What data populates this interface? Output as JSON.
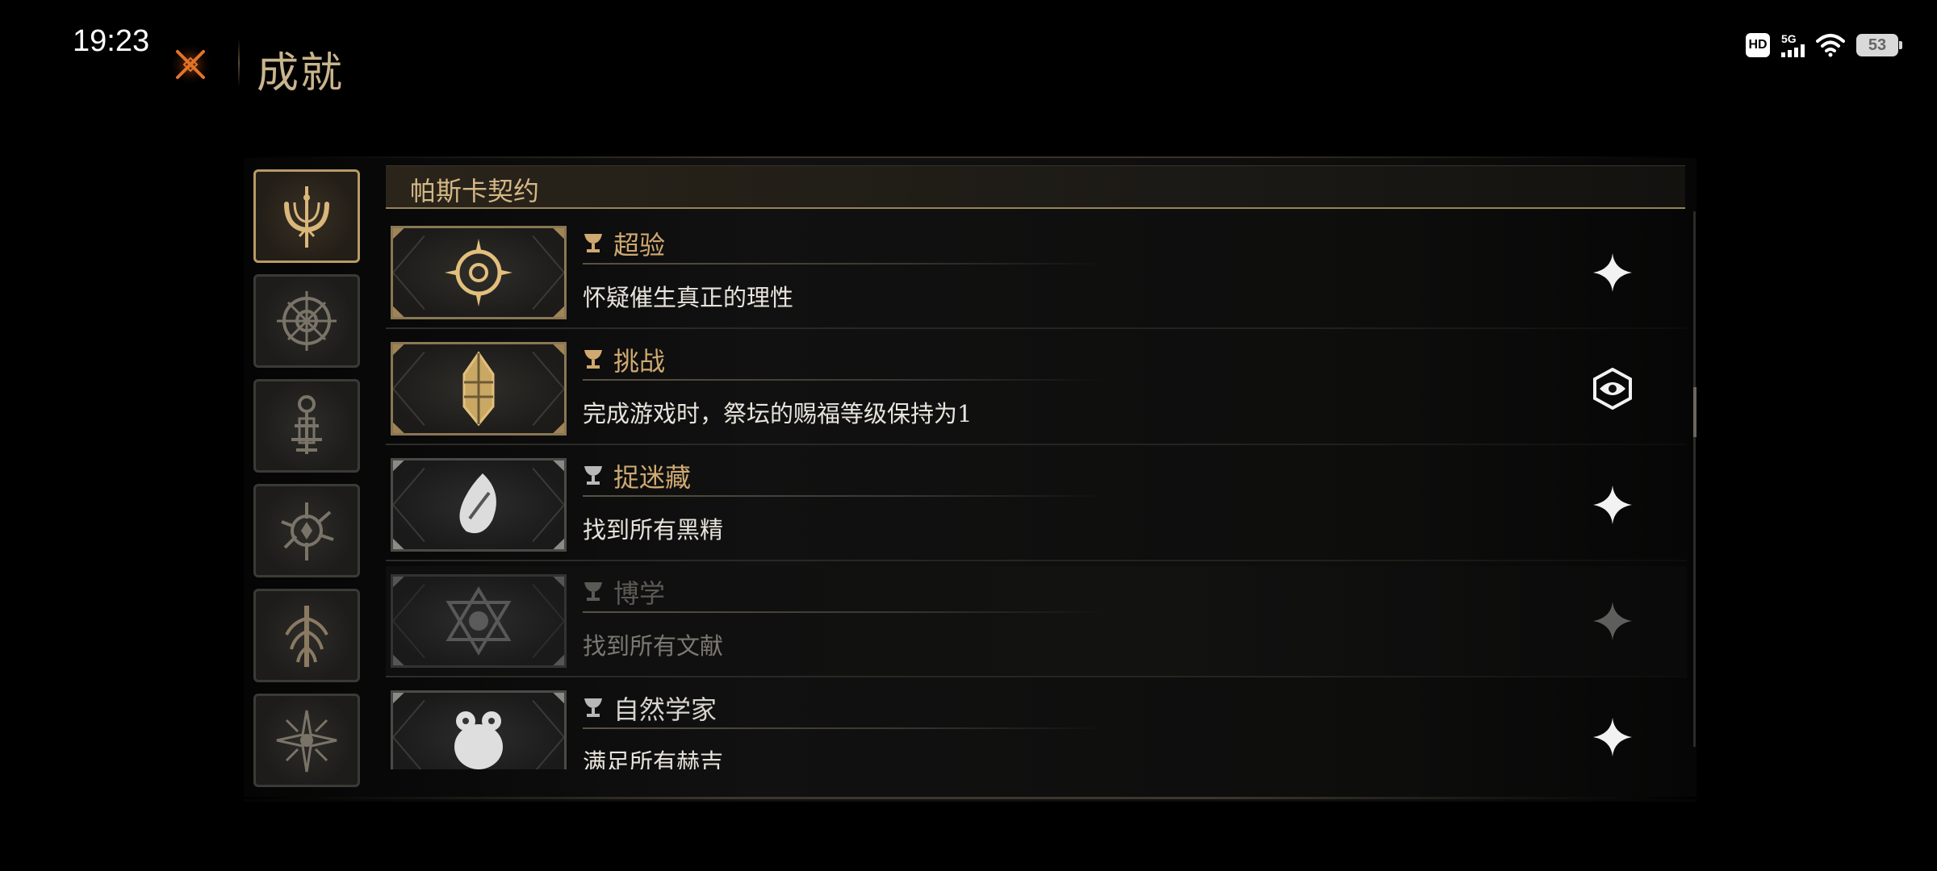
{
  "status_bar": {
    "time": "19:23",
    "hd_label": "HD",
    "network_label": "5G",
    "battery_level": "53"
  },
  "header": {
    "title": "成就"
  },
  "section": {
    "title": "帕斯卡契约"
  },
  "categories": [
    {
      "icon": "ornate-arch-icon",
      "active": true
    },
    {
      "icon": "compass-sigil-icon",
      "active": false
    },
    {
      "icon": "lantern-sigil-icon",
      "active": false
    },
    {
      "icon": "thorn-sigil-icon",
      "active": false
    },
    {
      "icon": "tree-sigil-icon",
      "active": false
    },
    {
      "icon": "starburst-sigil-icon",
      "active": false
    }
  ],
  "achievements": [
    {
      "title": "超验",
      "description": "怀疑催生真正的理性",
      "unlocked": true,
      "tier": "gold",
      "status_icon": "sparkle-icon"
    },
    {
      "title": "挑战",
      "description": "完成游戏时，祭坛的赐福等级保持为1",
      "unlocked": true,
      "tier": "gold",
      "status_icon": "eye-emblem-icon"
    },
    {
      "title": "捉迷藏",
      "description": "找到所有黑精",
      "unlocked": true,
      "tier": "silver",
      "status_icon": "sparkle-icon"
    },
    {
      "title": "博学",
      "description": "找到所有文献",
      "unlocked": false,
      "tier": "silver",
      "status_icon": "sparkle-icon"
    },
    {
      "title": "自然学家",
      "description": "满足所有赫吉",
      "unlocked": true,
      "tier": "silver",
      "status_icon": "sparkle-icon"
    }
  ],
  "colors": {
    "accent_gold": "#cfa970",
    "title_gold": "#c9b48d",
    "close_orange": "#e0742a"
  }
}
